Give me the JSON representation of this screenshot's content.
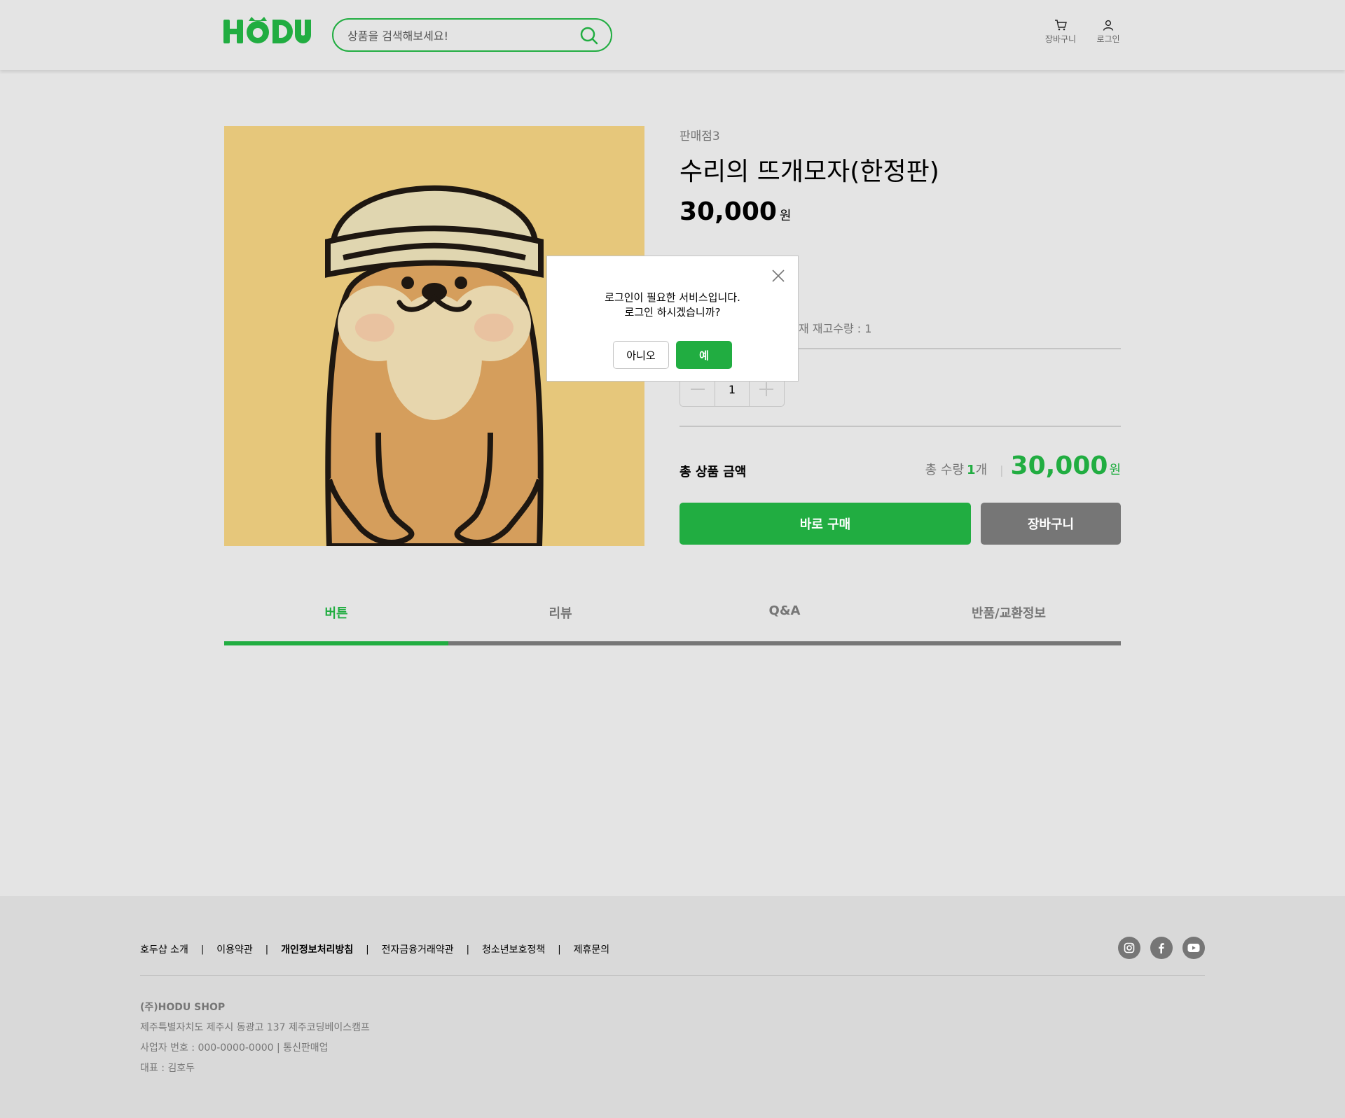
{
  "header": {
    "logo": "HODU",
    "search_placeholder": "상품을 검색해보세요!",
    "cart_label": "장바구니",
    "login_label": "로그인"
  },
  "product": {
    "seller": "판매점3",
    "name": "수리의 뜨개모자(한정판)",
    "price": "30,000",
    "price_unit": "원",
    "stock_text": "재 재고수량 : 1",
    "quantity": "1",
    "total_label": "총 상품 금액",
    "total_qty_label": "총 수량",
    "total_qty": "1",
    "total_qty_unit": "개",
    "total_sep": "|",
    "total_price": "30,000",
    "total_unit": "원",
    "buy_label": "바로 구매",
    "cart_label": "장바구니"
  },
  "tabs": [
    {
      "label": "버튼",
      "active": true
    },
    {
      "label": "리뷰",
      "active": false
    },
    {
      "label": "Q&A",
      "active": false
    },
    {
      "label": "반품/교환정보",
      "active": false
    }
  ],
  "modal": {
    "line1": "로그인이 필요한 서비스입니다.",
    "line2": "로그인 하시겠습니까?",
    "no_label": "아니오",
    "yes_label": "예"
  },
  "footer": {
    "links": [
      "호두샵 소개",
      "이용약관",
      "개인정보처리방침",
      "전자금융거래약관",
      "청소년보호정책",
      "제휴문의"
    ],
    "separator": "|",
    "company": "(주)HODU SHOP",
    "address": "제주특별자치도 제주시 동광고 137 제주코딩베이스캠프",
    "business": "사업자 번호 : 000-0000-0000 | 통신판매업",
    "ceo": "대표 : 김호두"
  },
  "colors": {
    "accent": "#21ad41",
    "gray": "#767676",
    "background": "#e4e4e4"
  }
}
